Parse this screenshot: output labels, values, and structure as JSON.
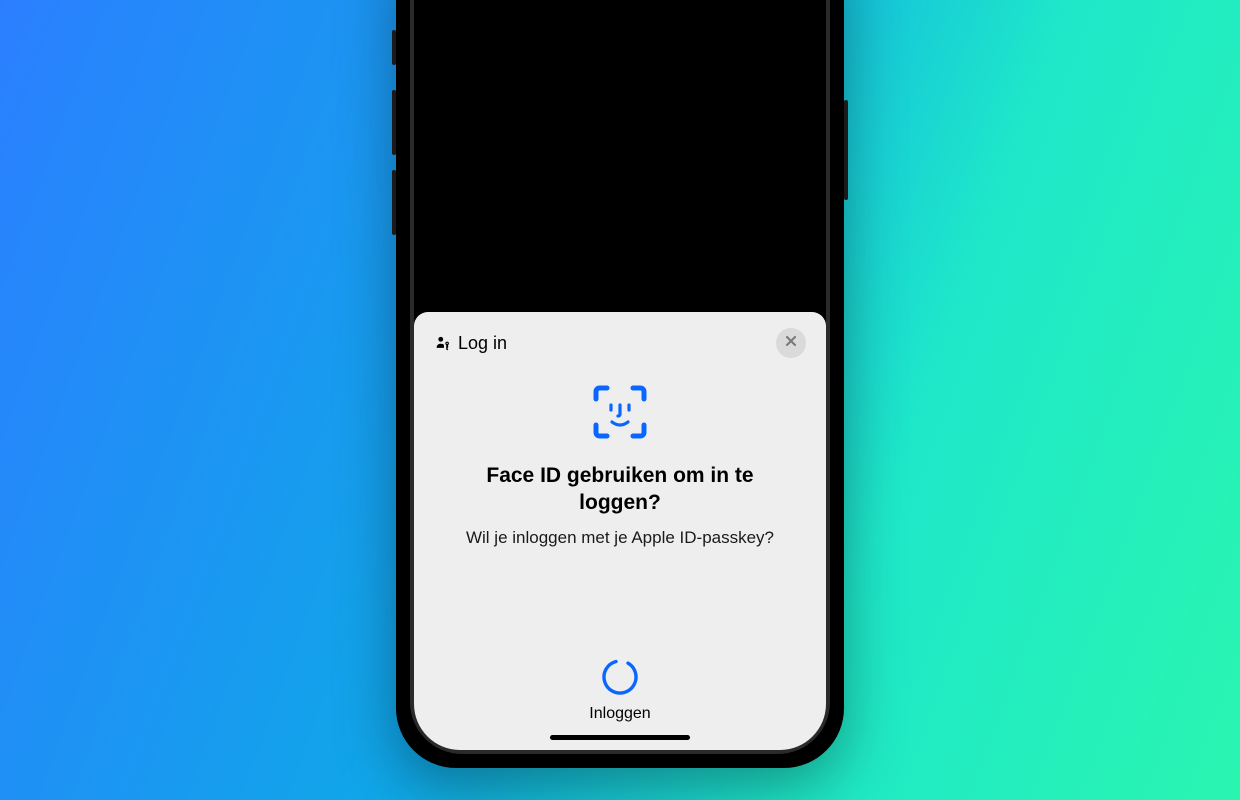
{
  "sheet": {
    "title": "Log in",
    "prompt_title": "Face ID gebruiken om in te loggen?",
    "prompt_subtitle": "Wil je inloggen met je Apple ID-passkey?",
    "action_label": "Inloggen"
  },
  "colors": {
    "accent": "#0A66FF",
    "sheet_bg": "#EEEEEE",
    "close_bg": "#DADADA",
    "close_x": "#7A7A7A"
  }
}
